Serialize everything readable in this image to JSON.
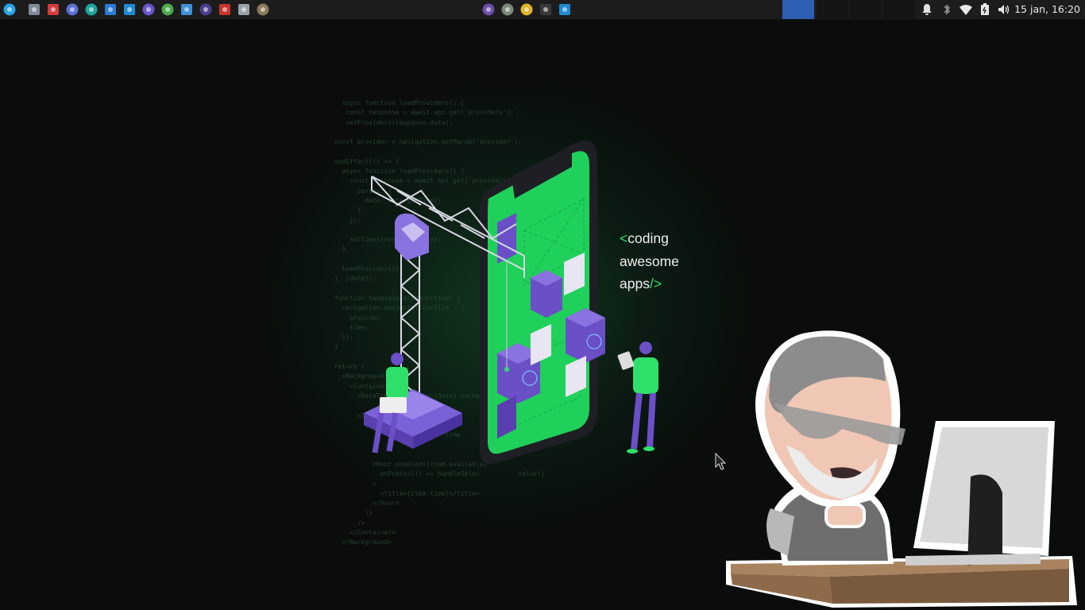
{
  "taskbar": {
    "launchers": [
      {
        "name": "start-menu-icon",
        "color": "#2aa3e0"
      },
      {
        "name": "file-manager-icon",
        "color": "#7d8a99"
      },
      {
        "name": "app-red-icon",
        "color": "#d63b3b"
      },
      {
        "name": "compass-icon",
        "color": "#5b6fd6"
      },
      {
        "name": "teal-app-icon",
        "color": "#1fa39a"
      },
      {
        "name": "vm-icon",
        "color": "#2b7bd6"
      },
      {
        "name": "vscode-icon",
        "color": "#1f8ad2"
      },
      {
        "name": "round-app-icon",
        "color": "#6a55c9"
      },
      {
        "name": "mongodb-icon",
        "color": "#4aa84a"
      },
      {
        "name": "box-icon",
        "color": "#3f8fd9"
      },
      {
        "name": "eclipse-icon",
        "color": "#4a3f8c"
      },
      {
        "name": "filezilla-icon",
        "color": "#c8342d"
      },
      {
        "name": "inkscape-icon",
        "color": "#9aa1a8"
      },
      {
        "name": "gimp-icon",
        "color": "#8a7a5a"
      }
    ],
    "window_buttons": [
      {
        "name": "tor-window-icon",
        "color": "#6b4fa8"
      },
      {
        "name": "app-window-icon",
        "color": "#7a8a7a"
      },
      {
        "name": "chrome-window-icon",
        "color": "#e0b32a"
      },
      {
        "name": "folder-window-icon",
        "color": "#3a3a3a"
      },
      {
        "name": "vscode-window-icon",
        "color": "#1f8ad2"
      }
    ],
    "tray": [
      "notification-icon",
      "bluetooth-icon",
      "wifi-icon",
      "battery-icon",
      "volume-icon"
    ],
    "clock": "15 jan, 16:20"
  },
  "wallpaper": {
    "tagline": {
      "line1_prefix": "<",
      "line1": "coding",
      "line2": "awesome",
      "line3": "apps",
      "line3_suffix": "/>"
    },
    "code": "   async function loadProviders() {\n    const response = await api.get('providers');\n    setProviders(response.data);\n\n const provider = navigation.getParam('provider');\n\n useEffect(() => {\n   async function loadProviders() {\n     const response = await api.get(`providers/${provider\n       params: {\n         date: date.getTime(),\n       },\n     });\n\n     setTimes(response.data);\n   }\n\n   loadProviders();\n }, [date]);\n\n function handleSelectHour(time) {\n   navigation.navigate('Confirm', {\n     provider,\n     time,\n   });\n }\n\n return (\n   <Background>\n     <Container>\n       <DateTimeInput date={date} onChange\n\n       <Time\n         data\n                              time\n\n\n           <Hour enabled={item.availab|e}\n             onPress={() => handleSelec          value)}\n           >\n             <Title>{item.time}</Title>\n           </Hour>\n         )}\n       />\n     </Container>\n   </Background>"
  }
}
